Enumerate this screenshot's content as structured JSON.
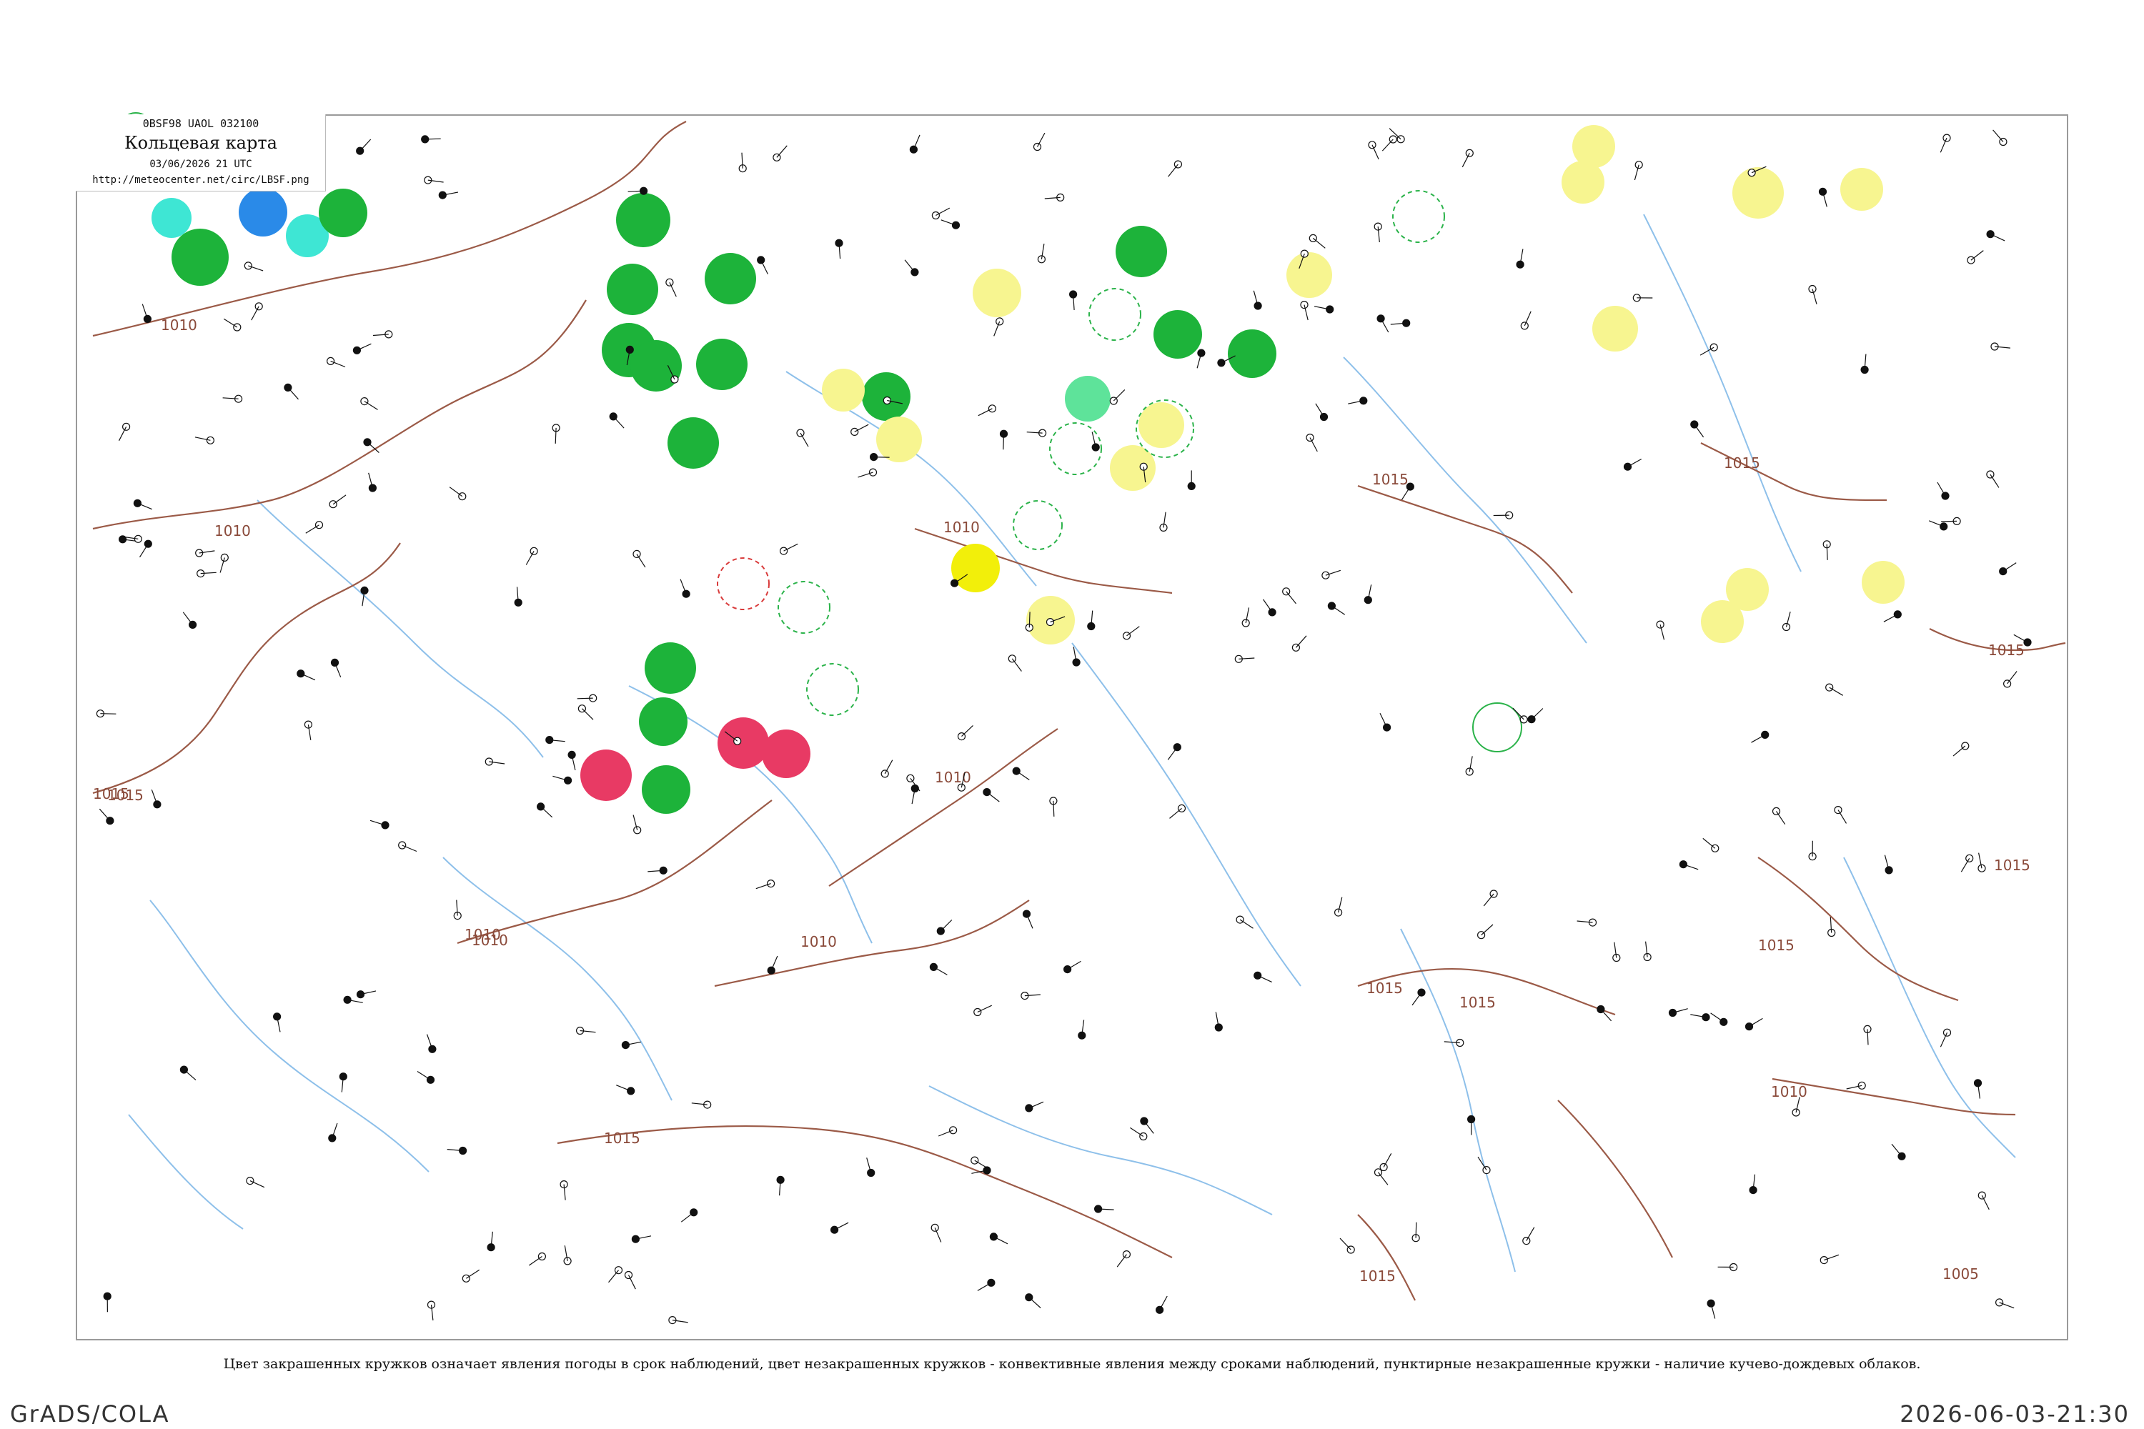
{
  "header": {
    "code": "0BSF98 UAOL 032100",
    "title": "Кольцевая карта",
    "valid_time": "03/06/2026 21 UTC",
    "url": "http://meteocenter.net/circ/LBSF.png"
  },
  "caption": "Цвет закрашенных кружков означает явления погоды в срок наблюдений, цвет незакрашенных кружков - конвективные явления между сроками наблюдений, пунктирные незакрашенные кружки - наличие кучево-дождевых облаков.",
  "footer": {
    "left": "GrADS/COLA",
    "right": "2026-06-03-21:30"
  },
  "isobar_labels": [
    "1010",
    "1010",
    "1010",
    "1015",
    "1010",
    "1015",
    "1010",
    "1010",
    "1015",
    "1015",
    "1015",
    "1015",
    "1015",
    "1015",
    "1010",
    "1015",
    "1015",
    "1005",
    "1015",
    "1010"
  ],
  "colors": {
    "isobar": "#9b5a47",
    "river": "#8ec0ea",
    "frame": "#9a9a9a",
    "rain": "#1db33a",
    "thunder_lightgreen": "#5ee39a",
    "fog_yellow": "#f7f590",
    "strong_yellow": "#f2ef0a",
    "hail_red": "#e83a64",
    "snow_blue": "#2a8ae8",
    "cyan": "#3ee6d4",
    "convective_outline": "#2bb34a",
    "cb_outline_red": "#d93a3a"
  }
}
